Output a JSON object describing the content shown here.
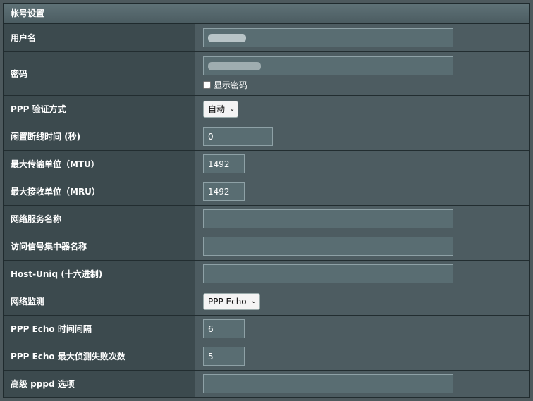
{
  "section_title": "帐号设置",
  "rows": {
    "username": {
      "label": "用户名"
    },
    "password": {
      "label": "密码",
      "show_password_label": "显示密码"
    },
    "ppp_auth": {
      "label": "PPP 验证方式",
      "selected": "自动"
    },
    "idle_disconnect": {
      "label": "闲置断线时间 (秒)",
      "value": "0"
    },
    "mtu": {
      "label": "最大传输单位（MTU）",
      "value": "1492"
    },
    "mru": {
      "label": "最大接收单位（MRU）",
      "value": "1492"
    },
    "service_name": {
      "label": "网络服务名称",
      "value": ""
    },
    "ac_name": {
      "label": "访问信号集中器名称",
      "value": ""
    },
    "host_uniq": {
      "label": "Host-Uniq (十六进制)",
      "value": ""
    },
    "net_monitor": {
      "label": "网络监测",
      "selected": "PPP Echo"
    },
    "echo_interval": {
      "label": "PPP Echo 时间间隔",
      "value": "6"
    },
    "echo_max_fail": {
      "label": "PPP Echo 最大侦测失败次数",
      "value": "5"
    },
    "pppd_options": {
      "label": "高级 pppd 选项",
      "value": ""
    }
  },
  "icons": {
    "select_chevron": "chevron-down-icon"
  }
}
